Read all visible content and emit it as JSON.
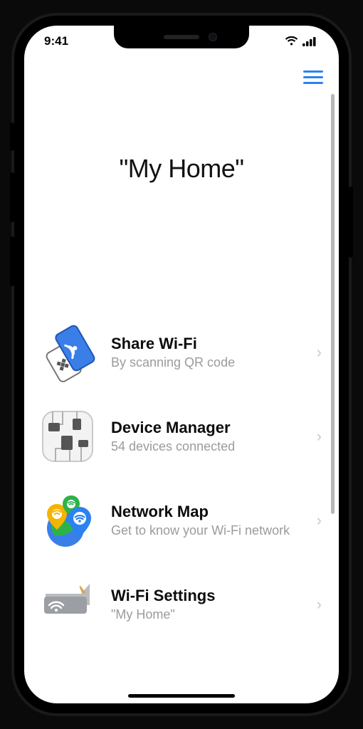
{
  "status": {
    "time": "9:41"
  },
  "hero": {
    "title": "\"My Home\""
  },
  "items": [
    {
      "title": "Share Wi-Fi",
      "sub": "By scanning QR code"
    },
    {
      "title": "Device Manager",
      "sub": "54 devices connected"
    },
    {
      "title": "Network Map",
      "sub": "Get to know your Wi-Fi network"
    },
    {
      "title": "Wi-Fi Settings",
      "sub": "\"My Home\""
    }
  ]
}
